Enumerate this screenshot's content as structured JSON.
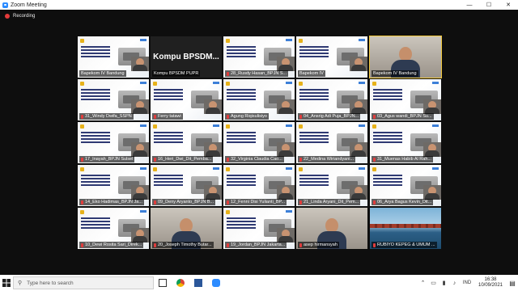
{
  "window": {
    "title": "Zoom Meeting",
    "minimize": "—",
    "maximize": "☐",
    "close": "✕"
  },
  "meeting": {
    "recording_label": "Recording"
  },
  "tiles": [
    {
      "name": "Bapekom IV Bandung",
      "kind": "slide-pip",
      "muted": false
    },
    {
      "name": "Kompu BPSDM PUPR",
      "kind": "text",
      "text": "Kompu  BPSDM...",
      "muted": false
    },
    {
      "name": "28_Rusdy Hasan_BPJN S...",
      "kind": "slide-pip",
      "muted": true
    },
    {
      "name": "Bapekom IV",
      "kind": "slide-pip",
      "muted": false
    },
    {
      "name": "Bapekom IV Bandung",
      "kind": "person",
      "muted": false,
      "active": true
    },
    {
      "name": "31_Windy Dwifa_SSPN",
      "kind": "slide-pip",
      "muted": true
    },
    {
      "name": "Ferry tatawi",
      "kind": "slide-pip",
      "muted": true
    },
    {
      "name": "Agung Riqisulisiyo",
      "kind": "slide-pip",
      "muted": true
    },
    {
      "name": "04_Ansrig Adi Puja_BPJN...",
      "kind": "slide-pip",
      "muted": true
    },
    {
      "name": "03_Agus wandi_BPJN Su...",
      "kind": "slide-pip",
      "muted": true
    },
    {
      "name": "17_Inayah_BPJN Sulsel",
      "kind": "slide-pip",
      "muted": true
    },
    {
      "name": "16_Heri_Dwi_Dit_Pemba...",
      "kind": "slide-pip",
      "muted": true
    },
    {
      "name": "32_Virginia Claudia Cao...",
      "kind": "slide-pip",
      "muted": true
    },
    {
      "name": "22_Medina Wiriandyani...",
      "kind": "slide-pip",
      "muted": true
    },
    {
      "name": "31_Muenas Habib Al Rah...",
      "kind": "slide-pip",
      "muted": true
    },
    {
      "name": "14_Eko Hadimas_BPJN Ja...",
      "kind": "slide-pip",
      "muted": true
    },
    {
      "name": "09_Deny Aryanto_BPJN B...",
      "kind": "slide-pip",
      "muted": true
    },
    {
      "name": "12_Fenni Disi Yulianti_BP...",
      "kind": "slide-pip",
      "muted": true
    },
    {
      "name": "21_Linda Aryani_Dit_Pem...",
      "kind": "slide-pip",
      "muted": true
    },
    {
      "name": "06_Arya Bagus Kevin_Dit...",
      "kind": "slide-pip",
      "muted": true
    },
    {
      "name": "10_Dewi Rosita Sari_Direk...",
      "kind": "slide-pip",
      "muted": true
    },
    {
      "name": "20_Joseph Timothy Butar...",
      "kind": "person",
      "muted": true
    },
    {
      "name": "19_Jordan_BPJN Jakarta...",
      "kind": "slide-pip",
      "muted": true
    },
    {
      "name": "asep hirmansyah",
      "kind": "person",
      "muted": true
    },
    {
      "name": "RUBIYO KEPEG & UMUM ...",
      "kind": "sea",
      "muted": true
    }
  ],
  "taskbar": {
    "search_placeholder": "Type here to search",
    "lang": "IND",
    "time": "16:38",
    "date": "10/09/2021"
  },
  "colors": {
    "accent": "#2d8cff",
    "active_border": "#f2c83b",
    "mute": "#e13c3c"
  }
}
